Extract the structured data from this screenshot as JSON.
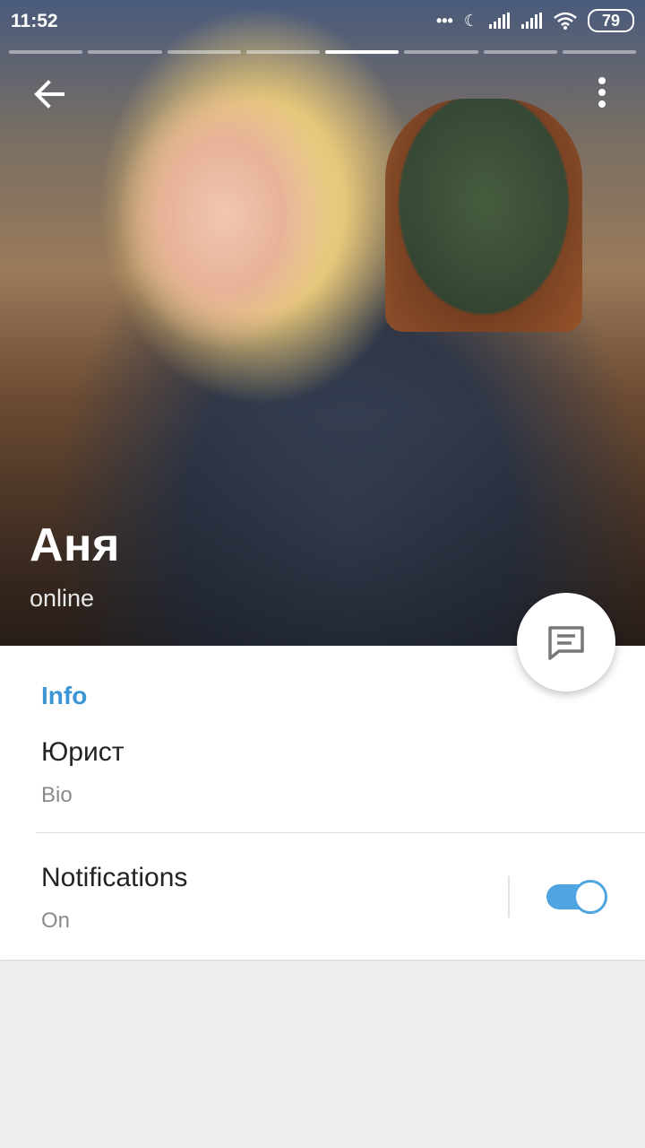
{
  "status_bar": {
    "time": "11:52",
    "battery": "79",
    "icons": [
      "more-dots-icon",
      "moon-icon",
      "signal-icon",
      "signal-icon",
      "wifi-icon",
      "battery-icon"
    ]
  },
  "story": {
    "segments": 8,
    "active_segment": 5
  },
  "profile": {
    "name": "Аня",
    "presence": "online"
  },
  "info": {
    "section_title": "Info",
    "bio_value": "Юрист",
    "bio_label": "Bio",
    "notifications_title": "Notifications",
    "notifications_state": "On",
    "notifications_enabled": true
  },
  "colors": {
    "accent": "#3a95d5",
    "toggle": "#4ea5e0"
  }
}
